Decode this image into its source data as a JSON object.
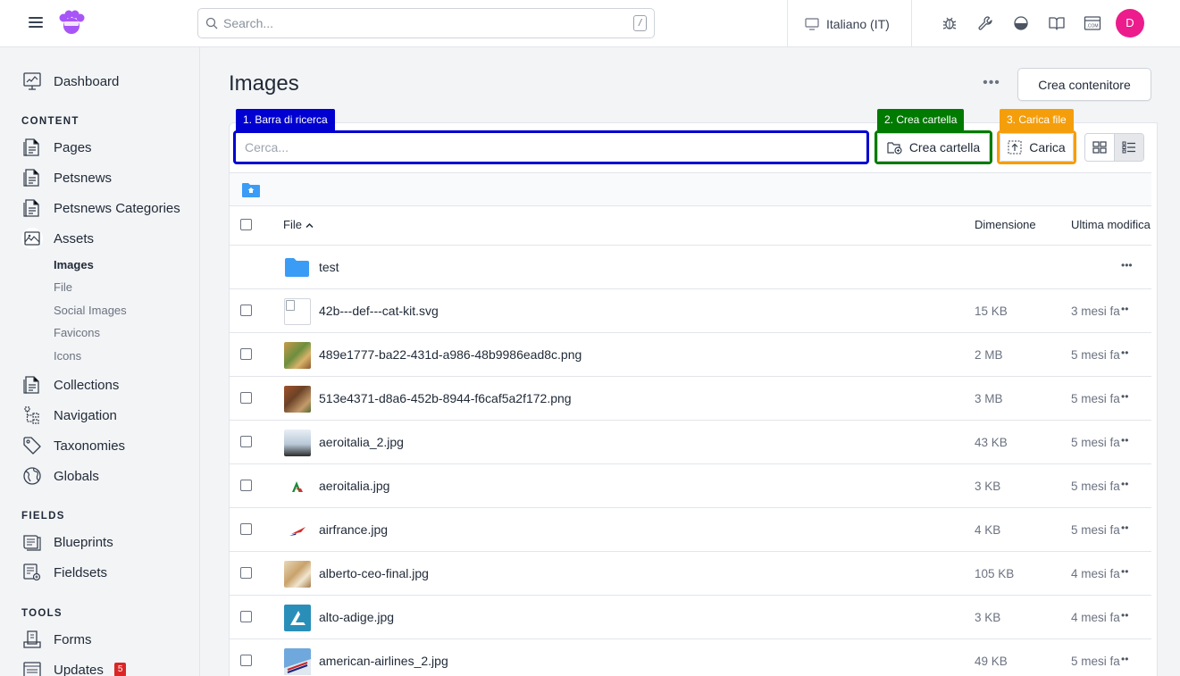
{
  "topbar": {
    "search_placeholder": "Search...",
    "search_shortcut": "/",
    "site_label": "Italiano (IT)",
    "avatar_initial": "D",
    "colors": {
      "avatar": "#ec1c8c"
    }
  },
  "sidebar": {
    "dashboard": "Dashboard",
    "content_heading": "CONTENT",
    "content": [
      "Pages",
      "Petsnews",
      "Petsnews Categories",
      "Assets"
    ],
    "assets_sub": [
      "Images",
      "File",
      "Social Images",
      "Favicons",
      "Icons"
    ],
    "content_more": [
      "Collections",
      "Navigation",
      "Taxonomies",
      "Globals"
    ],
    "fields_heading": "FIELDS",
    "fields": [
      "Blueprints",
      "Fieldsets"
    ],
    "tools_heading": "TOOLS",
    "tools": [
      "Forms",
      "Updates"
    ],
    "updates_badge": "5"
  },
  "main": {
    "title": "Images",
    "more_actions": "•••",
    "create_container": "Crea contenitore",
    "search_placeholder": "Cerca...",
    "create_folder": "Crea cartella",
    "upload": "Carica",
    "annotations": [
      {
        "label": "1. Barra di ricerca",
        "color": "#0000d1"
      },
      {
        "label": "2. Crea cartella",
        "color": "#007a00"
      },
      {
        "label": "3. Carica file",
        "color": "#f59e0b"
      }
    ],
    "columns": {
      "file": "File",
      "size": "Dimensione",
      "modified": "Ultima modifica"
    },
    "folder": {
      "name": "test"
    },
    "files": [
      {
        "name": "42b---def---cat-kit.svg",
        "size": "15 KB",
        "modified": "3 mesi fa"
      },
      {
        "name": "489e1777-ba22-431d-a986-48b9986ead8c.png",
        "size": "2 MB",
        "modified": "5 mesi fa"
      },
      {
        "name": "513e4371-d8a6-452b-8944-f6caf5a2f172.png",
        "size": "3 MB",
        "modified": "5 mesi fa"
      },
      {
        "name": "aeroitalia_2.jpg",
        "size": "43 KB",
        "modified": "5 mesi fa"
      },
      {
        "name": "aeroitalia.jpg",
        "size": "3 KB",
        "modified": "5 mesi fa"
      },
      {
        "name": "airfrance.jpg",
        "size": "4 KB",
        "modified": "5 mesi fa"
      },
      {
        "name": "alberto-ceo-final.jpg",
        "size": "105 KB",
        "modified": "4 mesi fa"
      },
      {
        "name": "alto-adige.jpg",
        "size": "3 KB",
        "modified": "4 mesi fa"
      },
      {
        "name": "american-airlines_2.jpg",
        "size": "49 KB",
        "modified": "5 mesi fa"
      }
    ]
  }
}
